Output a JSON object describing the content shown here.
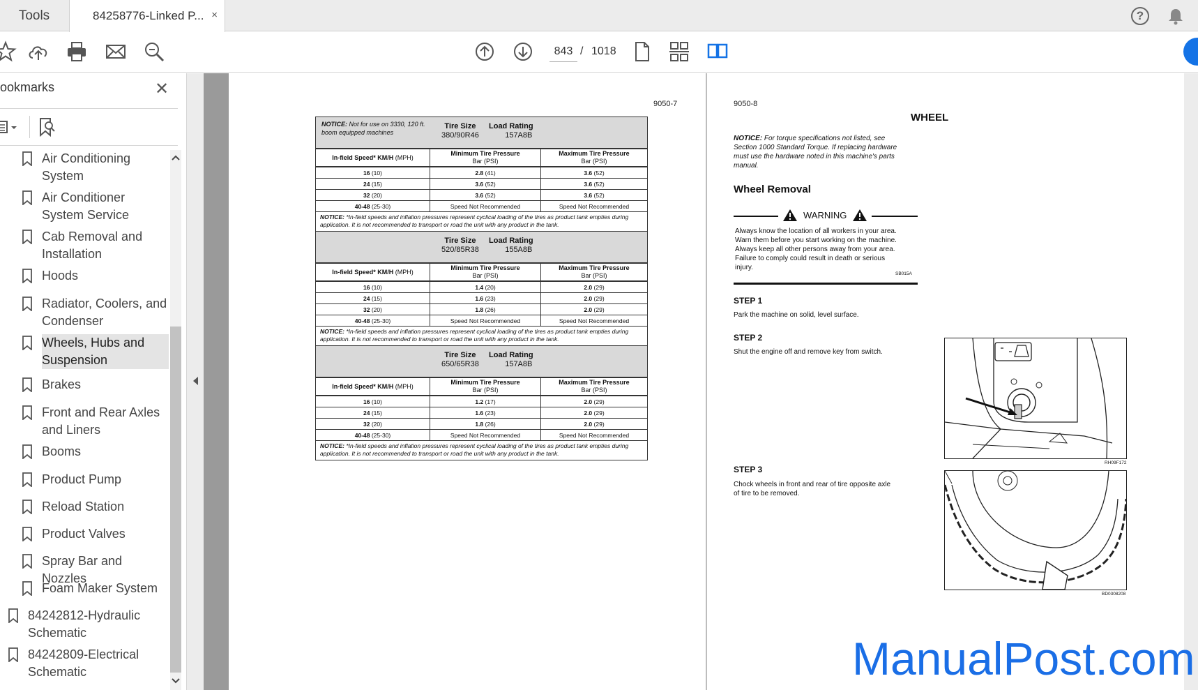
{
  "tabs": {
    "tools_label": "Tools",
    "document_label": "84258776-Linked P...",
    "close_glyph": "×"
  },
  "toolbar": {
    "current_page": "843",
    "separator": "/",
    "total_pages": "1018"
  },
  "sidebar": {
    "title": "ookmarks",
    "close_glyph": "✕",
    "items": [
      {
        "label": "Air Conditioning System",
        "lines": [
          "Air Conditioning",
          "System"
        ]
      },
      {
        "label": "Air Conditioner System Service",
        "lines": [
          "Air Conditioner",
          "System Service"
        ]
      },
      {
        "label": "Cab Removal and Installation",
        "lines": [
          "Cab Removal and",
          "Installation"
        ]
      },
      {
        "label": "Hoods",
        "lines": [
          "Hoods"
        ]
      },
      {
        "label": "Radiator, Coolers, and Condenser",
        "lines": [
          "Radiator, Coolers, and",
          "Condenser"
        ]
      },
      {
        "label": "Wheels, Hubs and Suspension",
        "lines": [
          "Wheels, Hubs and",
          "Suspension"
        ]
      },
      {
        "label": "Brakes",
        "lines": [
          "Brakes"
        ]
      },
      {
        "label": "Front and Rear Axles and Liners",
        "lines": [
          "Front and Rear Axles",
          "and Liners"
        ]
      },
      {
        "label": "Booms",
        "lines": [
          "Booms"
        ]
      },
      {
        "label": "Product Pump",
        "lines": [
          "Product Pump"
        ]
      },
      {
        "label": "Reload Station",
        "lines": [
          "Reload Station"
        ]
      },
      {
        "label": "Product Valves",
        "lines": [
          "Product Valves"
        ]
      },
      {
        "label": "Spray Bar and Nozzles",
        "lines": [
          "Spray Bar and Nozzles"
        ]
      },
      {
        "label": "Foam Maker System",
        "lines": [
          "Foam Maker System"
        ]
      },
      {
        "label": "84242812-Hydraulic Schematic",
        "lines": [
          "84242812-Hydraulic",
          "Schematic"
        ]
      },
      {
        "label": "84242809-Electrical Schematic",
        "lines": [
          "84242809-Electrical",
          "Schematic"
        ]
      }
    ]
  },
  "left_page": {
    "page_number": "9050-7",
    "header_notice": {
      "bold": "NOTICE:",
      "text": " Not for use on 3330, 120 ft. boom equipped machines"
    },
    "col_tire_size": "Tire Size",
    "col_load_rating": "Load Rating",
    "col_speed": "In-field Speed* KM/H",
    "col_speed_unit": " (MPH)",
    "col_min": "Minimum Tire Pressure",
    "col_max": "Maximum Tire Pressure",
    "col_bar": "Bar (PSI)",
    "footnote_bold": "NOTICE:",
    "footnote": " *In-field speeds and inflation pressures represent cyclical loading of the tires as product tank empties during application. It is not recommended to transport or road the unit with any product in the tank.",
    "tables": [
      {
        "tire_size": "380/90R46",
        "load_rating": "157A8B",
        "rows": [
          {
            "speed": "16",
            "mph": " (10)",
            "min": "2.8",
            "min_psi": " (41)",
            "max": "3.6",
            "max_psi": " (52)"
          },
          {
            "speed": "24",
            "mph": " (15)",
            "min": "3.6",
            "min_psi": " (52)",
            "max": "3.6",
            "max_psi": " (52)"
          },
          {
            "speed": "32",
            "mph": " (20)",
            "min": "3.6",
            "min_psi": " (52)",
            "max": "3.6",
            "max_psi": " (52)"
          },
          {
            "speed": "40-48",
            "mph": " (25-30)",
            "min": "Speed Not Recommended",
            "min_psi": "",
            "max": "Speed Not Recommended",
            "max_psi": ""
          }
        ]
      },
      {
        "tire_size": "520/85R38",
        "load_rating": "155A8B",
        "rows": [
          {
            "speed": "16",
            "mph": " (10)",
            "min": "1.4",
            "min_psi": " (20)",
            "max": "2.0",
            "max_psi": " (29)"
          },
          {
            "speed": "24",
            "mph": " (15)",
            "min": "1.6",
            "min_psi": " (23)",
            "max": "2.0",
            "max_psi": " (29)"
          },
          {
            "speed": "32",
            "mph": " (20)",
            "min": "1.8",
            "min_psi": " (26)",
            "max": "2.0",
            "max_psi": " (29)"
          },
          {
            "speed": "40-48",
            "mph": " (25-30)",
            "min": "Speed Not Recommended",
            "min_psi": "",
            "max": "Speed Not Recommended",
            "max_psi": ""
          }
        ]
      },
      {
        "tire_size": "650/65R38",
        "load_rating": "157A8B",
        "rows": [
          {
            "speed": "16",
            "mph": " (10)",
            "min": "1.2",
            "min_psi": " (17)",
            "max": "2.0",
            "max_psi": " (29)"
          },
          {
            "speed": "24",
            "mph": " (15)",
            "min": "1.6",
            "min_psi": " (23)",
            "max": "2.0",
            "max_psi": " (29)"
          },
          {
            "speed": "32",
            "mph": " (20)",
            "min": "1.8",
            "min_psi": " (26)",
            "max": "2.0",
            "max_psi": " (29)"
          },
          {
            "speed": "40-48",
            "mph": " (25-30)",
            "min": "Speed Not Recommended",
            "min_psi": "",
            "max": "Speed Not Recommended",
            "max_psi": ""
          }
        ]
      }
    ]
  },
  "right_page": {
    "page_number": "9050-8",
    "heading": "WHEEL",
    "notice_bold": "NOTICE:",
    "notice_lines": [
      " For torque specifications not listed, see",
      "Section 1000 Standard Torque. If replacing hardware",
      "must use the hardware noted in this machine's parts",
      "manual."
    ],
    "section_title": "Wheel Removal",
    "warning_label": "WARNING",
    "warning_lines": [
      "Always know the location of all workers in your area.",
      "Warn them before you start working on the machine.",
      "Always keep all other persons away from your area.",
      "Failure to comply could result in death or serious",
      "injury."
    ],
    "warning_code": "SB015A",
    "steps": [
      {
        "title": "STEP  1",
        "lines": [
          "Park the machine on solid, level surface."
        ]
      },
      {
        "title": "STEP  2",
        "lines": [
          "Shut the engine off and remove key from switch."
        ]
      },
      {
        "title": "STEP  3",
        "lines": [
          "Chock wheels in front and rear of tire opposite axle",
          "of tire to be removed."
        ]
      }
    ],
    "figure1_code": "RH09F172",
    "figure2_code": "BD0308208"
  },
  "watermark": "ManualPost.com",
  "colors": {
    "accent": "#1473e6",
    "watermark": "#1a6ee6"
  }
}
